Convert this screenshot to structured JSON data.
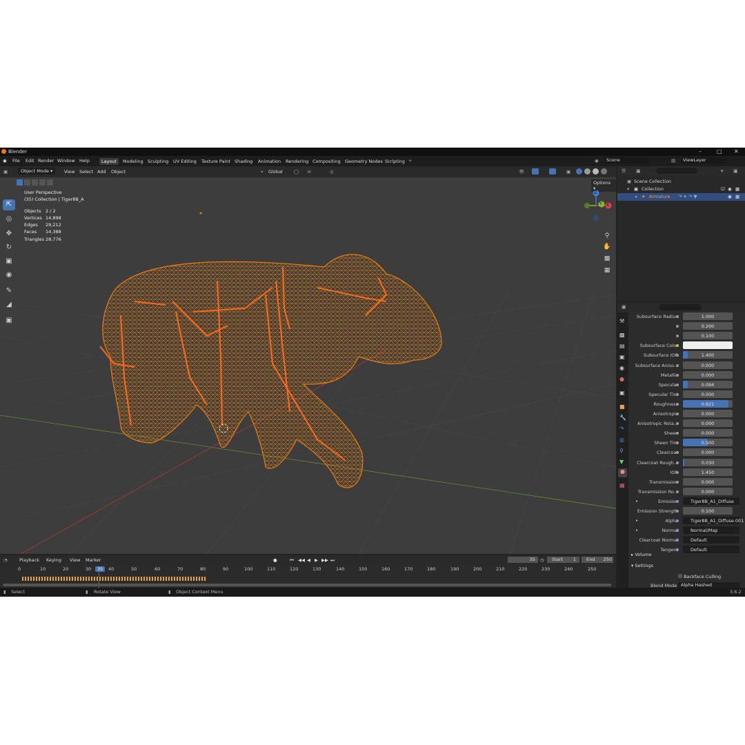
{
  "window": {
    "title": "Blender",
    "version": "3.6.2"
  },
  "menu": [
    "File",
    "Edit",
    "Render",
    "Window",
    "Help"
  ],
  "workspaces": [
    "Layout",
    "Modeling",
    "Sculpting",
    "UV Editing",
    "Texture Paint",
    "Shading",
    "Animation",
    "Rendering",
    "Compositing",
    "Geometry Nodes",
    "Scripting"
  ],
  "active_workspace": "Layout",
  "scene": {
    "name": "Scene",
    "view_layer": "ViewLayer"
  },
  "viewport_header": {
    "mode": "Object Mode",
    "menus": [
      "View",
      "Select",
      "Add",
      "Object"
    ],
    "orientation": "Global",
    "options": "Options"
  },
  "overlay": {
    "title": "User Perspective",
    "collection": "(35) Collection | Tiger8B_A",
    "stats": [
      {
        "k": "Objects",
        "v": "2 / 2"
      },
      {
        "k": "Vertices",
        "v": "14,898"
      },
      {
        "k": "Edges",
        "v": "29,212"
      },
      {
        "k": "Faces",
        "v": "14,388"
      },
      {
        "k": "Triangles",
        "v": "28,776"
      }
    ]
  },
  "gizmo": {
    "x": "X",
    "y": "Y",
    "z": "Z"
  },
  "outliner": {
    "root": "Scene Collection",
    "collection": "Collection",
    "armature": "Armature"
  },
  "properties": [
    {
      "label": "Subsurface Radius",
      "value": "1.000",
      "type": "num"
    },
    {
      "label": "",
      "value": "0.200",
      "type": "num"
    },
    {
      "label": "",
      "value": "0.100",
      "type": "num"
    },
    {
      "label": "Subsurface Color",
      "value": "",
      "type": "color"
    },
    {
      "label": "Subsurface IOR",
      "value": "1.400",
      "type": "num",
      "fill": 0.1
    },
    {
      "label": "Subsurface Aniso...",
      "value": "0.000",
      "type": "num"
    },
    {
      "label": "Metallic",
      "value": "0.000",
      "type": "num"
    },
    {
      "label": "Specular",
      "value": "0.094",
      "type": "num",
      "fill": 0.094
    },
    {
      "label": "Specular Tint",
      "value": "0.000",
      "type": "num"
    },
    {
      "label": "Roughness",
      "value": "0.921",
      "type": "num",
      "fill": 0.921
    },
    {
      "label": "Anisotropic",
      "value": "0.000",
      "type": "num"
    },
    {
      "label": "Anisotropic Rota...",
      "value": "0.000",
      "type": "num"
    },
    {
      "label": "Sheen",
      "value": "0.000",
      "type": "num"
    },
    {
      "label": "Sheen Tint",
      "value": "0.500",
      "type": "num",
      "fill": 0.5
    },
    {
      "label": "Clearcoat",
      "value": "0.000",
      "type": "num"
    },
    {
      "label": "Clearcoat Rough...",
      "value": "0.030",
      "type": "num",
      "fill": 0.03
    },
    {
      "label": "IOR",
      "value": "1.450",
      "type": "num"
    },
    {
      "label": "Transmission",
      "value": "0.000",
      "type": "num"
    },
    {
      "label": "Transmission Ro...",
      "value": "0.000",
      "type": "num"
    },
    {
      "label": "Emission",
      "value": "Tiger8B_A1_Diffuse",
      "type": "link",
      "expand": true
    },
    {
      "label": "Emission Strength",
      "value": "0.100",
      "type": "num"
    },
    {
      "label": "Alpha",
      "value": "Tiger8B_A1_Diffuse.001",
      "type": "link",
      "expand": true
    },
    {
      "label": "Normal",
      "value": "Normal/Map",
      "type": "link",
      "expand": true
    },
    {
      "label": "Clearcoat Normal",
      "value": "Default",
      "type": "link"
    },
    {
      "label": "Tangent",
      "value": "Default",
      "type": "link"
    }
  ],
  "panels": {
    "volume": "Volume",
    "settings": "Settings",
    "backface": "Backface Culling",
    "blend_mode_label": "Blend Mode",
    "blend_mode": "Alpha Hashed"
  },
  "timeline": {
    "menus": [
      "Playback",
      "Keying",
      "View",
      "Marker"
    ],
    "current": "35",
    "start_label": "Start",
    "start": "1",
    "end_label": "End",
    "end": "250",
    "ticks": [
      "0",
      "10",
      "20",
      "30",
      "35",
      "40",
      "50",
      "60",
      "70",
      "80",
      "90",
      "100",
      "110",
      "120",
      "130",
      "140",
      "150",
      "160",
      "170",
      "180",
      "190",
      "200",
      "210",
      "220",
      "230",
      "240",
      "250"
    ]
  },
  "status": {
    "select": "Select",
    "rotate": "Rotate View",
    "context": "Object Context Menu"
  },
  "colors": {
    "accent": "#4772b3",
    "wire": "#e87d0d",
    "bone": "#ff6a1a"
  }
}
